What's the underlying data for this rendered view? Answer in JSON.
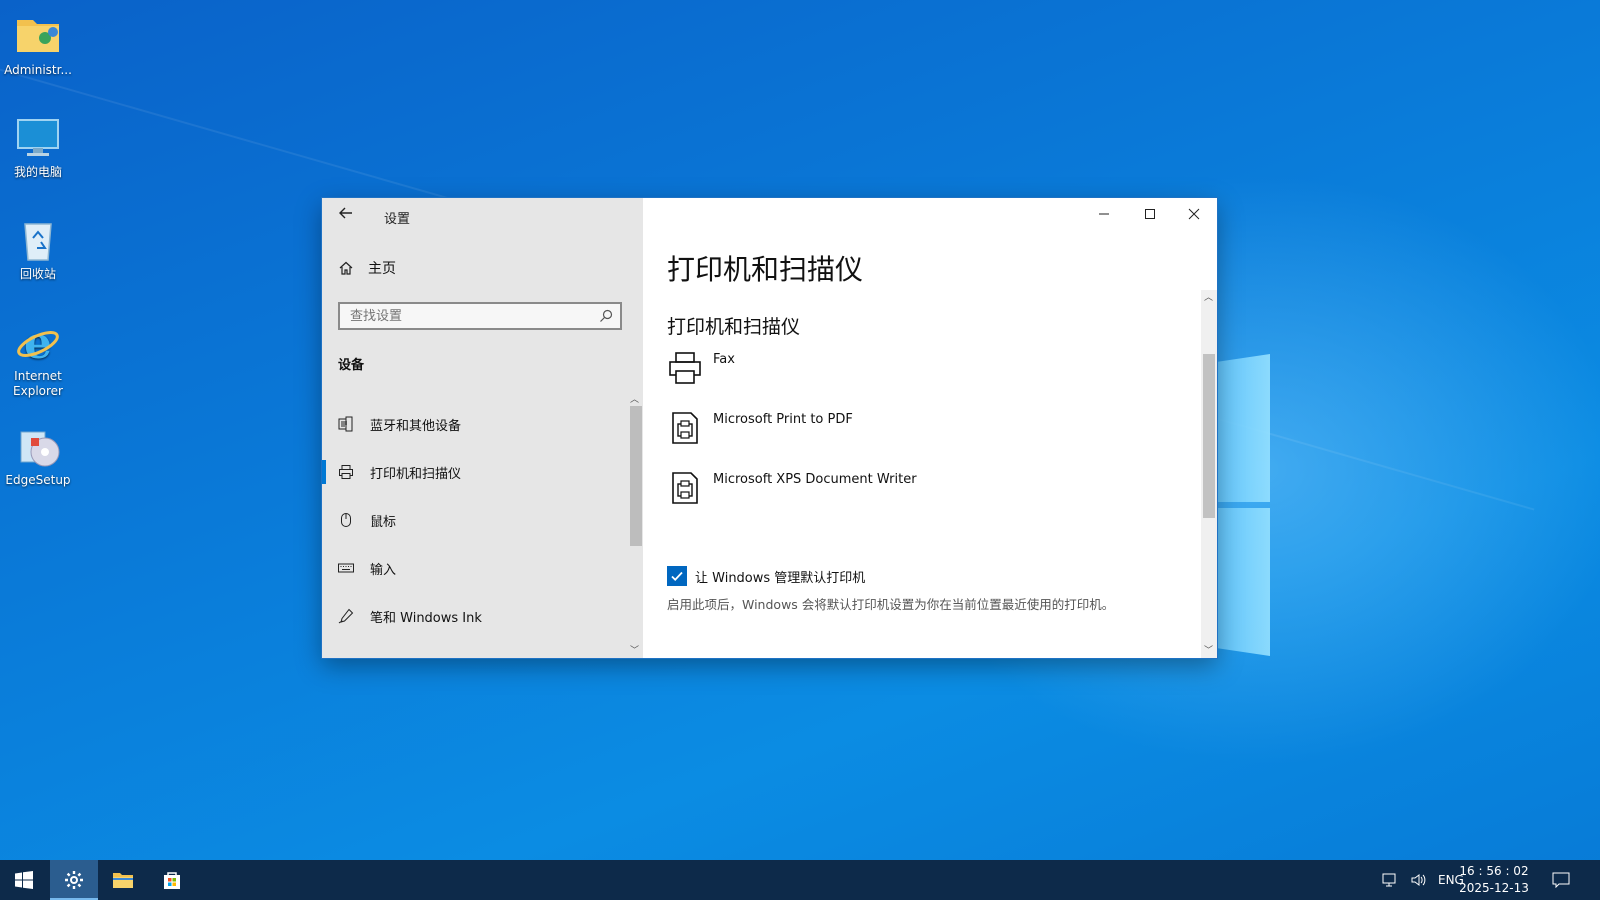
{
  "desktop": {
    "icons": [
      {
        "label": "Administr..."
      },
      {
        "label": "我的电脑"
      },
      {
        "label": "回收站"
      },
      {
        "label": "Internet Explorer"
      },
      {
        "label": "EdgeSetup"
      }
    ]
  },
  "window": {
    "title": "设置",
    "sidebar": {
      "home_label": "主页",
      "search_placeholder": "查找设置",
      "section_label": "设备",
      "nav": [
        {
          "label": "蓝牙和其他设备",
          "icon": "bluetooth-devices-icon",
          "active": false
        },
        {
          "label": "打印机和扫描仪",
          "icon": "printer-icon",
          "active": true
        },
        {
          "label": "鼠标",
          "icon": "mouse-icon",
          "active": false
        },
        {
          "label": "输入",
          "icon": "keyboard-icon",
          "active": false
        },
        {
          "label": "笔和 Windows Ink",
          "icon": "pen-icon",
          "active": false
        }
      ]
    },
    "main": {
      "page_title": "打印机和扫描仪",
      "section_title": "打印机和扫描仪",
      "printers": [
        {
          "name": "Fax",
          "icon": "fax-printer-icon"
        },
        {
          "name": "Microsoft Print to PDF",
          "icon": "document-printer-icon"
        },
        {
          "name": "Microsoft XPS Document Writer",
          "icon": "document-printer-icon"
        }
      ],
      "default_printer_checkbox": {
        "label": "让 Windows 管理默认打印机",
        "checked": true
      },
      "default_printer_desc": "启用此项后，Windows 会将默认打印机设置为你在当前位置最近使用的打印机。"
    }
  },
  "taskbar": {
    "language": "ENG",
    "time": "16 : 56 : 02",
    "date": "2025-12-13"
  },
  "colors": {
    "accent": "#0078d4",
    "checkbox": "#0067c0",
    "taskbar": "#0d2a4a",
    "sidebar_bg": "#e6e6e6"
  }
}
